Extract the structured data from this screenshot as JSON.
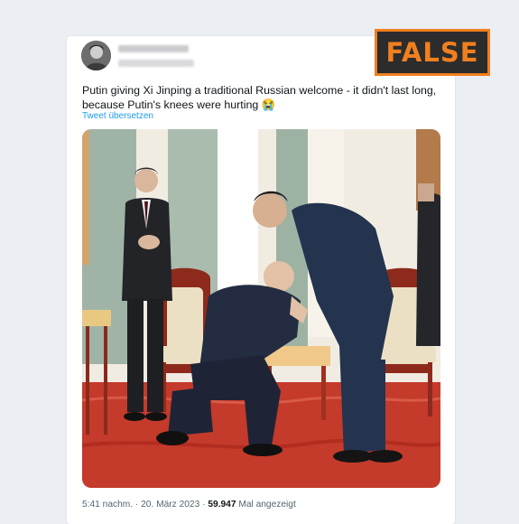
{
  "tweet": {
    "text": "Putin giving Xi Jinping a traditional Russian welcome - it didn't last long, because Putin's knees were hurting 😭",
    "translate_link": "Tweet übersetzen",
    "time": "5:41 nachm.",
    "separator": " · ",
    "date": "20. März 2023",
    "views": "59.947",
    "views_label": "Mal angezeigt"
  },
  "badge": {
    "label": "FALSE"
  },
  "colors": {
    "badge_accent": "#f07f1f",
    "link": "#1d9bf0",
    "carpet": "#c43a2b"
  },
  "icons": {
    "avatar": "profile-photo-blurred"
  }
}
